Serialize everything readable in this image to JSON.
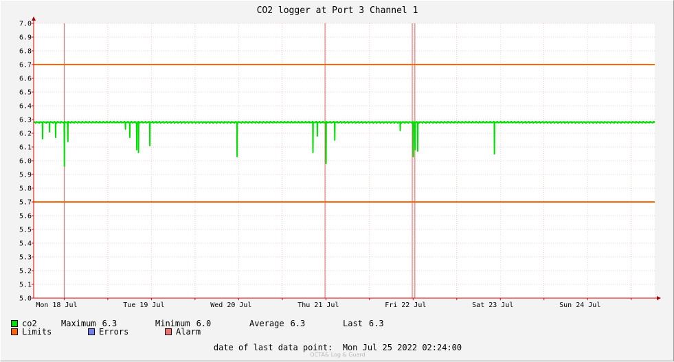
{
  "chart_data": {
    "type": "line",
    "title": "CO2 logger at Port 3 Channel 1",
    "xlabel": "",
    "ylabel": "",
    "ylim": [
      5.0,
      7.0
    ],
    "y_ticks": [
      "5.0",
      "5.1",
      "5.2",
      "5.3",
      "5.4",
      "5.5",
      "5.6",
      "5.7",
      "5.8",
      "5.9",
      "6.0",
      "6.1",
      "6.2",
      "6.3",
      "6.4",
      "6.5",
      "6.6",
      "6.7",
      "6.8",
      "6.9",
      "7.0"
    ],
    "x_unit": "day index (0 = Mon 18 Jul 00:00)",
    "xlim": [
      -0.35,
      6.77
    ],
    "x_ticks": [
      {
        "label": "Mon 18 Jul",
        "x": 0
      },
      {
        "label": "Tue 19 Jul",
        "x": 1
      },
      {
        "label": "Wed 20 Jul",
        "x": 2
      },
      {
        "label": "Thu 21 Jul",
        "x": 3
      },
      {
        "label": "Fri 22 Jul",
        "x": 4
      },
      {
        "label": "Sat 23 Jul",
        "x": 5
      },
      {
        "label": "Sun 24 Jul",
        "x": 6
      }
    ],
    "grid": true,
    "series": [
      {
        "name": "co2",
        "color": "#00e000",
        "baseline": 6.28,
        "x": [
          -0.35,
          6.77
        ],
        "dips": [
          {
            "x": -0.25,
            "y": 6.16
          },
          {
            "x": -0.17,
            "y": 6.21
          },
          {
            "x": -0.1,
            "y": 6.17
          },
          {
            "x": 0.0,
            "y": 5.96
          },
          {
            "x": 0.04,
            "y": 6.14
          },
          {
            "x": 0.7,
            "y": 6.23
          },
          {
            "x": 0.75,
            "y": 6.17
          },
          {
            "x": 0.83,
            "y": 6.08
          },
          {
            "x": 0.85,
            "y": 6.06
          },
          {
            "x": 0.98,
            "y": 6.11
          },
          {
            "x": 1.98,
            "y": 6.03
          },
          {
            "x": 2.85,
            "y": 6.06
          },
          {
            "x": 2.9,
            "y": 6.18
          },
          {
            "x": 3.0,
            "y": 5.98
          },
          {
            "x": 3.1,
            "y": 6.15
          },
          {
            "x": 3.85,
            "y": 6.22
          },
          {
            "x": 4.0,
            "y": 6.03
          },
          {
            "x": 4.02,
            "y": 6.08
          },
          {
            "x": 4.05,
            "y": 6.07
          },
          {
            "x": 4.93,
            "y": 6.05
          }
        ]
      }
    ],
    "limits": {
      "name": "Limits",
      "color": "#ff6600",
      "values": [
        6.7,
        5.7
      ]
    },
    "alarm_lines": {
      "color": "#e06060",
      "x": [
        0.0,
        2.99,
        3.99,
        4.02
      ]
    }
  },
  "legend": {
    "co2": {
      "label": "co2",
      "color": "#00e000"
    },
    "stats": [
      {
        "label": "Maximum",
        "value": "6.3"
      },
      {
        "label": "Minimum",
        "value": "6.0"
      },
      {
        "label": "Average",
        "value": "6.3"
      },
      {
        "label": "Last",
        "value": "6.3"
      }
    ],
    "limits": {
      "label": "Limits",
      "color": "#ff6600"
    },
    "errors": {
      "label": "Errors",
      "color": "#7080f0"
    },
    "alarm": {
      "label": "Alarm",
      "color": "#f07070"
    }
  },
  "footer": {
    "label": "date of last data point:",
    "value": "Mon Jul 25 2022 02:24:00"
  },
  "watermark": "OCTA& Log & Guard"
}
